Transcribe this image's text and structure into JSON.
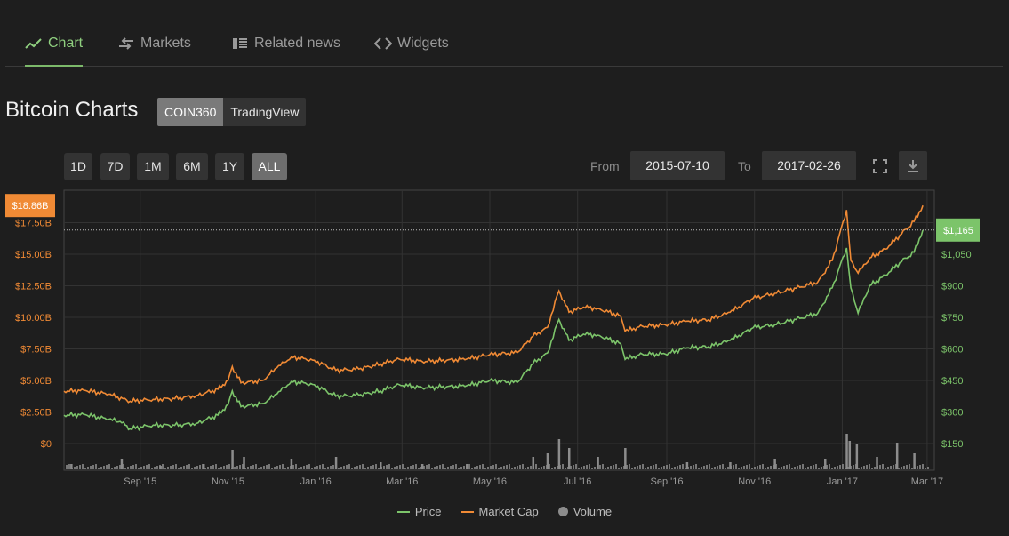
{
  "tabs": [
    {
      "label": "Chart",
      "icon": "line-chart-icon"
    },
    {
      "label": "Markets",
      "icon": "exchange-icon"
    },
    {
      "label": "Related news",
      "icon": "news-icon"
    },
    {
      "label": "Widgets",
      "icon": "code-icon"
    }
  ],
  "page_title": "Bitcoin Charts",
  "source_toggle": {
    "coin360": "COIN360",
    "tradingview": "TradingView"
  },
  "ranges": [
    "1D",
    "7D",
    "1M",
    "6M",
    "1Y",
    "ALL"
  ],
  "selected_range": "ALL",
  "date_range": {
    "from_label": "From",
    "from": "2015-07-10",
    "to_label": "To",
    "to": "2017-02-26"
  },
  "colors": {
    "price": "#7cc46a",
    "market_cap": "#f08a35",
    "volume": "#8c8c8c",
    "background": "#1e1e1e"
  },
  "chart_data": {
    "type": "line",
    "x_ticks": [
      "Sep '15",
      "Nov '15",
      "Jan '16",
      "Mar '16",
      "May '16",
      "Jul '16",
      "Sep '16",
      "Nov '16",
      "Jan '17",
      "Mar '17"
    ],
    "left_axis": {
      "ticks": [
        "$0",
        "$2.50B",
        "$5.00B",
        "$7.50B",
        "$10.00B",
        "$12.50B",
        "$15.00B",
        "$17.50B"
      ],
      "range": [
        0,
        20
      ],
      "unit": "B"
    },
    "right_axis": {
      "ticks": [
        "$150",
        "$300",
        "$450",
        "$600",
        "$750",
        "$900",
        "$1,050"
      ],
      "range": [
        150,
        1200
      ]
    },
    "current_market_cap_label": "$18.86B",
    "current_price_label": "$1,165",
    "current_price": 1165,
    "grid": true,
    "legend_position": "bottom",
    "series": [
      {
        "name": "Price",
        "axis": "right",
        "points": [
          [
            "2015-07-10",
            285
          ],
          [
            "2015-07-25",
            287
          ],
          [
            "2015-08-10",
            265
          ],
          [
            "2015-08-18",
            255
          ],
          [
            "2015-08-25",
            220
          ],
          [
            "2015-09-10",
            238
          ],
          [
            "2015-09-25",
            236
          ],
          [
            "2015-10-10",
            246
          ],
          [
            "2015-10-25",
            285
          ],
          [
            "2015-11-01",
            335
          ],
          [
            "2015-11-04",
            400
          ],
          [
            "2015-11-10",
            325
          ],
          [
            "2015-11-25",
            340
          ],
          [
            "2015-12-05",
            385
          ],
          [
            "2015-12-15",
            445
          ],
          [
            "2015-12-31",
            430
          ],
          [
            "2016-01-15",
            375
          ],
          [
            "2016-01-31",
            380
          ],
          [
            "2016-02-15",
            400
          ],
          [
            "2016-02-28",
            430
          ],
          [
            "2016-03-15",
            415
          ],
          [
            "2016-04-01",
            420
          ],
          [
            "2016-04-15",
            425
          ],
          [
            "2016-05-01",
            450
          ],
          [
            "2016-05-20",
            440
          ],
          [
            "2016-05-31",
            530
          ],
          [
            "2016-06-10",
            580
          ],
          [
            "2016-06-18",
            740
          ],
          [
            "2016-06-25",
            640
          ],
          [
            "2016-07-05",
            670
          ],
          [
            "2016-07-15",
            665
          ],
          [
            "2016-07-31",
            625
          ],
          [
            "2016-08-03",
            550
          ],
          [
            "2016-08-15",
            575
          ],
          [
            "2016-08-31",
            575
          ],
          [
            "2016-09-15",
            605
          ],
          [
            "2016-09-30",
            610
          ],
          [
            "2016-10-15",
            640
          ],
          [
            "2016-10-31",
            700
          ],
          [
            "2016-11-15",
            715
          ],
          [
            "2016-11-30",
            740
          ],
          [
            "2016-12-15",
            770
          ],
          [
            "2016-12-25",
            890
          ],
          [
            "2017-01-04",
            1080
          ],
          [
            "2017-01-07",
            890
          ],
          [
            "2017-01-12",
            770
          ],
          [
            "2017-01-20",
            900
          ],
          [
            "2017-01-31",
            950
          ],
          [
            "2017-02-10",
            1010
          ],
          [
            "2017-02-20",
            1060
          ],
          [
            "2017-02-26",
            1165
          ]
        ]
      },
      {
        "name": "Market Cap",
        "axis": "left",
        "points": [
          [
            "2015-07-10",
            4.15
          ],
          [
            "2015-07-25",
            4.2
          ],
          [
            "2015-08-10",
            3.9
          ],
          [
            "2015-08-25",
            3.35
          ],
          [
            "2015-09-10",
            3.5
          ],
          [
            "2015-09-25",
            3.55
          ],
          [
            "2015-10-10",
            3.8
          ],
          [
            "2015-10-25",
            4.3
          ],
          [
            "2015-11-01",
            5.0
          ],
          [
            "2015-11-04",
            6.1
          ],
          [
            "2015-11-10",
            4.8
          ],
          [
            "2015-11-25",
            5.0
          ],
          [
            "2015-12-05",
            6.0
          ],
          [
            "2015-12-15",
            6.85
          ],
          [
            "2015-12-31",
            6.6
          ],
          [
            "2016-01-15",
            5.8
          ],
          [
            "2016-01-31",
            5.9
          ],
          [
            "2016-02-15",
            6.3
          ],
          [
            "2016-02-28",
            6.7
          ],
          [
            "2016-03-15",
            6.5
          ],
          [
            "2016-04-01",
            6.6
          ],
          [
            "2016-04-15",
            6.7
          ],
          [
            "2016-05-01",
            7.05
          ],
          [
            "2016-05-20",
            7.2
          ],
          [
            "2016-05-31",
            8.5
          ],
          [
            "2016-06-10",
            9.2
          ],
          [
            "2016-06-18",
            12.1
          ],
          [
            "2016-06-25",
            10.4
          ],
          [
            "2016-07-05",
            10.8
          ],
          [
            "2016-07-15",
            10.7
          ],
          [
            "2016-07-31",
            10.1
          ],
          [
            "2016-08-03",
            8.9
          ],
          [
            "2016-08-15",
            9.3
          ],
          [
            "2016-08-31",
            9.4
          ],
          [
            "2016-09-15",
            9.7
          ],
          [
            "2016-09-30",
            9.8
          ],
          [
            "2016-10-15",
            10.4
          ],
          [
            "2016-10-31",
            11.5
          ],
          [
            "2016-11-15",
            11.9
          ],
          [
            "2016-11-30",
            12.3
          ],
          [
            "2016-12-15",
            12.8
          ],
          [
            "2016-12-25",
            14.5
          ],
          [
            "2017-01-04",
            18.5
          ],
          [
            "2017-01-07",
            14.5
          ],
          [
            "2017-01-12",
            13.5
          ],
          [
            "2017-01-20",
            14.7
          ],
          [
            "2017-01-31",
            15.4
          ],
          [
            "2017-02-10",
            16.5
          ],
          [
            "2017-02-20",
            17.6
          ],
          [
            "2017-02-26",
            18.86
          ]
        ]
      },
      {
        "name": "Volume",
        "type": "bar",
        "points": [
          [
            "2015-07-15",
            0.15
          ],
          [
            "2015-08-19",
            0.3
          ],
          [
            "2015-09-15",
            0.1
          ],
          [
            "2015-10-15",
            0.15
          ],
          [
            "2015-11-04",
            0.55
          ],
          [
            "2015-11-12",
            0.35
          ],
          [
            "2015-12-15",
            0.3
          ],
          [
            "2016-01-15",
            0.35
          ],
          [
            "2016-02-15",
            0.2
          ],
          [
            "2016-03-15",
            0.15
          ],
          [
            "2016-04-15",
            0.15
          ],
          [
            "2016-05-31",
            0.35
          ],
          [
            "2016-06-10",
            0.45
          ],
          [
            "2016-06-18",
            0.85
          ],
          [
            "2016-06-25",
            0.6
          ],
          [
            "2016-07-15",
            0.35
          ],
          [
            "2016-08-03",
            0.6
          ],
          [
            "2016-09-15",
            0.2
          ],
          [
            "2016-10-15",
            0.2
          ],
          [
            "2016-11-15",
            0.3
          ],
          [
            "2016-12-20",
            0.3
          ],
          [
            "2017-01-04",
            1.0
          ],
          [
            "2017-01-06",
            0.8
          ],
          [
            "2017-01-11",
            0.7
          ],
          [
            "2017-01-25",
            0.35
          ],
          [
            "2017-02-08",
            0.75
          ],
          [
            "2017-02-20",
            0.45
          ]
        ]
      }
    ]
  }
}
